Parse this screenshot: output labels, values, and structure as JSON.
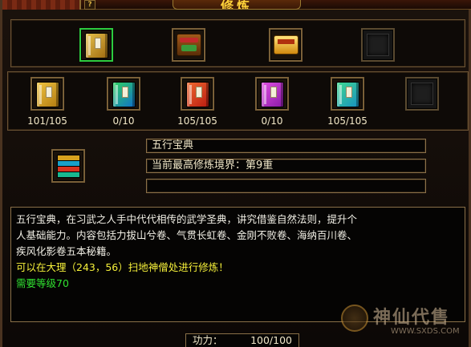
{
  "window": {
    "title": "修炼",
    "help_label": "?"
  },
  "top_slots": [
    {
      "name": "book-slot",
      "icon": "book-icon",
      "color": "#c99a2a",
      "highlighted": true
    },
    {
      "name": "treasure-chest-slot",
      "icon": "treasure-chest-icon"
    },
    {
      "name": "gold-ingot-slot",
      "icon": "gold-ingot-icon"
    },
    {
      "name": "empty-slot",
      "icon": "empty"
    }
  ],
  "scrolls": [
    {
      "name": "gold",
      "color": "#d8a21e",
      "count": "101/105"
    },
    {
      "name": "blue-green",
      "color": "#1aa0c8",
      "count": "0/10"
    },
    {
      "name": "red",
      "color": "#d8321e",
      "count": "105/105"
    },
    {
      "name": "purple",
      "color": "#c02ac8",
      "count": "0/10"
    },
    {
      "name": "teal",
      "color": "#18b890",
      "count": "105/105"
    }
  ],
  "selected": {
    "name": "五行宝典",
    "realm": "当前最高修炼境界：第9重",
    "extra": ""
  },
  "description": {
    "lines": [
      "五行宝典，在习武之人手中代代相传的武学圣典，讲究借鉴自然法则，提升个",
      "人基础能力。内容包括力拔山兮卷、气贯长虹卷、金刚不败卷、海纳百川卷、",
      "疾风化影卷五本秘籍。"
    ],
    "location": "可以在大理（243，56）扫地神僧处进行修炼！",
    "requirement": "需要等级70"
  },
  "power": {
    "label": "功力：",
    "value": "100/100"
  },
  "watermark": {
    "text": "神仙代售",
    "url": "WWW.SXDS.COM"
  },
  "colors": {
    "accent_gold": "#ffd23a",
    "location_yellow": "#f5f03a",
    "requirement_green": "#30e030"
  }
}
